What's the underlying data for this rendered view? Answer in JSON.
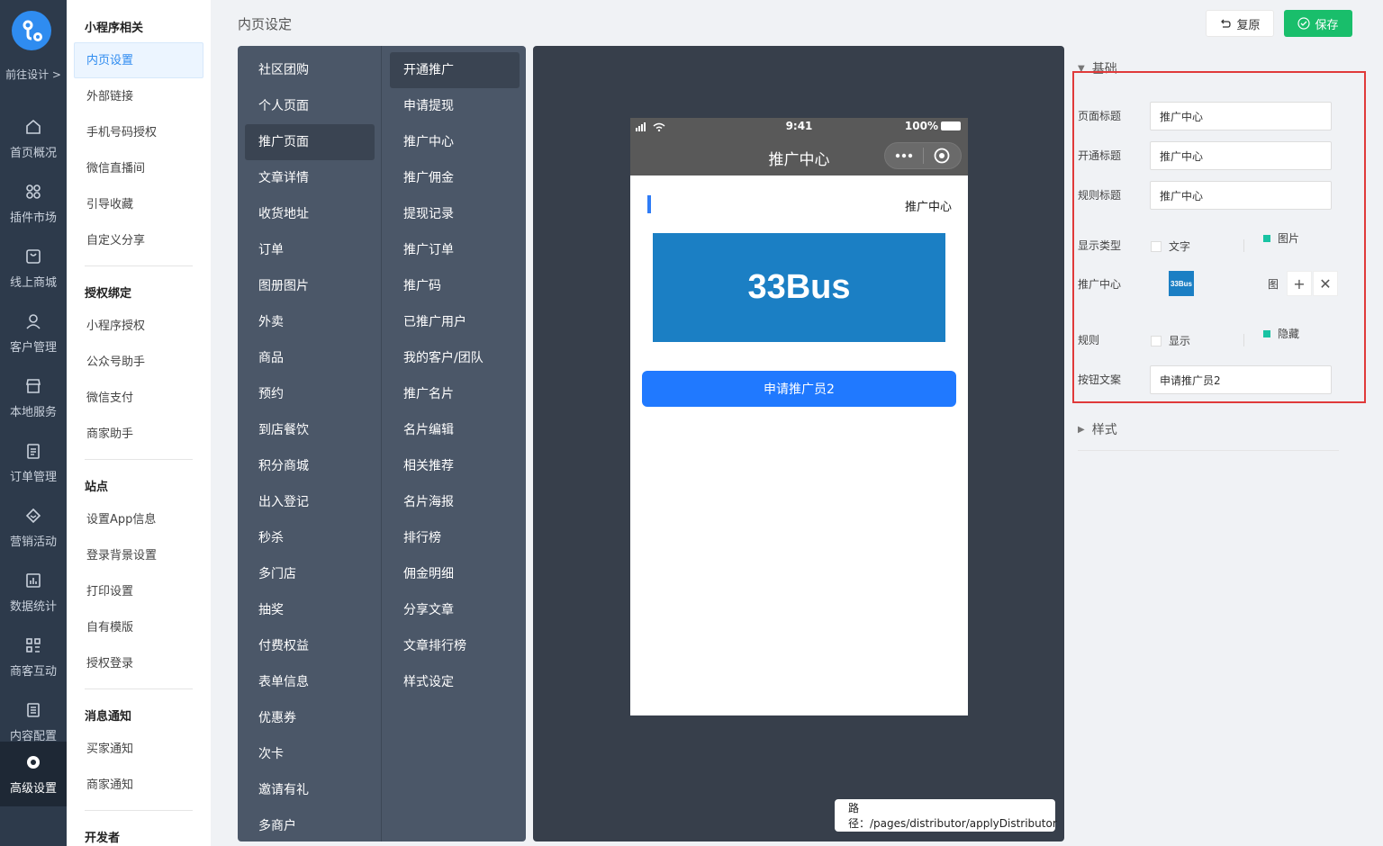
{
  "rail": {
    "design_link": "前往设计 >",
    "items": [
      {
        "label": "首页概况",
        "icon": "home-icon"
      },
      {
        "label": "插件市场",
        "icon": "grid-icon"
      },
      {
        "label": "线上商城",
        "icon": "shop-icon"
      },
      {
        "label": "客户管理",
        "icon": "user-icon"
      },
      {
        "label": "本地服务",
        "icon": "store-icon"
      },
      {
        "label": "订单管理",
        "icon": "clipboard-icon"
      },
      {
        "label": "营销活动",
        "icon": "diamond-icon"
      },
      {
        "label": "数据统计",
        "icon": "bar-chart-icon"
      },
      {
        "label": "商客互动",
        "icon": "scan-icon"
      },
      {
        "label": "内容配置",
        "icon": "document-icon"
      },
      {
        "label": "高级设置",
        "icon": "gear-icon"
      }
    ]
  },
  "sidebar": {
    "groups": [
      {
        "title": "小程序相关",
        "items": [
          "内页设置",
          "外部链接",
          "手机号码授权",
          "微信直播间",
          "引导收藏",
          "自定义分享"
        ]
      },
      {
        "title": "授权绑定",
        "items": [
          "小程序授权",
          "公众号助手",
          "微信支付",
          "商家助手"
        ]
      },
      {
        "title": "站点",
        "items": [
          "设置App信息",
          "登录背景设置",
          "打印设置",
          "自有模版",
          "授权登录"
        ]
      },
      {
        "title": "消息通知",
        "items": [
          "买家通知",
          "商家通知"
        ]
      },
      {
        "title": "开发者",
        "items": []
      }
    ]
  },
  "header": {
    "title": "内页设定",
    "reset_label": "复原",
    "save_label": "保存"
  },
  "pages": {
    "col1": [
      "社区团购",
      "个人页面",
      "推广页面",
      "文章详情",
      "收货地址",
      "订单",
      "图册图片",
      "外卖",
      "商品",
      "预约",
      "到店餐饮",
      "积分商城",
      "出入登记",
      "秒杀",
      "多门店",
      "抽奖",
      "付费权益",
      "表单信息",
      "优惠券",
      "次卡",
      "邀请有礼",
      "多商户"
    ],
    "col2": [
      "开通推广",
      "申请提现",
      "推广中心",
      "推广佣金",
      "提现记录",
      "推广订单",
      "推广码",
      "已推广用户",
      "我的客户/团队",
      "推广名片",
      "名片编辑",
      "相关推荐",
      "名片海报",
      "排行榜",
      "佣金明细",
      "分享文章",
      "文章排行榜",
      "样式设定"
    ]
  },
  "preview": {
    "time": "9:41",
    "battery": "100%",
    "nav_title": "推广中心",
    "page_title": "推广中心",
    "banner_text": "33Bus",
    "apply_button": "申请推广员2",
    "path": "路径：/pages/distributor/applyDistributor"
  },
  "settings": {
    "basic_title": "基础",
    "style_title": "样式",
    "page_title_label": "页面标题",
    "page_title_value": "推广中心",
    "open_title_label": "开通标题",
    "open_title_value": "推广中心",
    "rule_title_label": "规则标题",
    "rule_title_value": "推广中心",
    "display_type_label": "显示类型",
    "display_text": "文字",
    "display_image": "图片",
    "center_label": "推广中心",
    "thumb_text": "33Bus",
    "image_tag": "图",
    "rule_label": "规则",
    "rule_show": "显示",
    "rule_hide": "隐藏",
    "button_text_label": "按钮文案",
    "button_text_value": "申请推广员2"
  },
  "colors": {
    "rail_bg": "#2d3a4b",
    "accent": "#2f8cf0",
    "save_green": "#19be6b",
    "apply_blue": "#2079ff",
    "highlight_red": "#e03a3a",
    "radio_teal": "#19c3a3"
  }
}
